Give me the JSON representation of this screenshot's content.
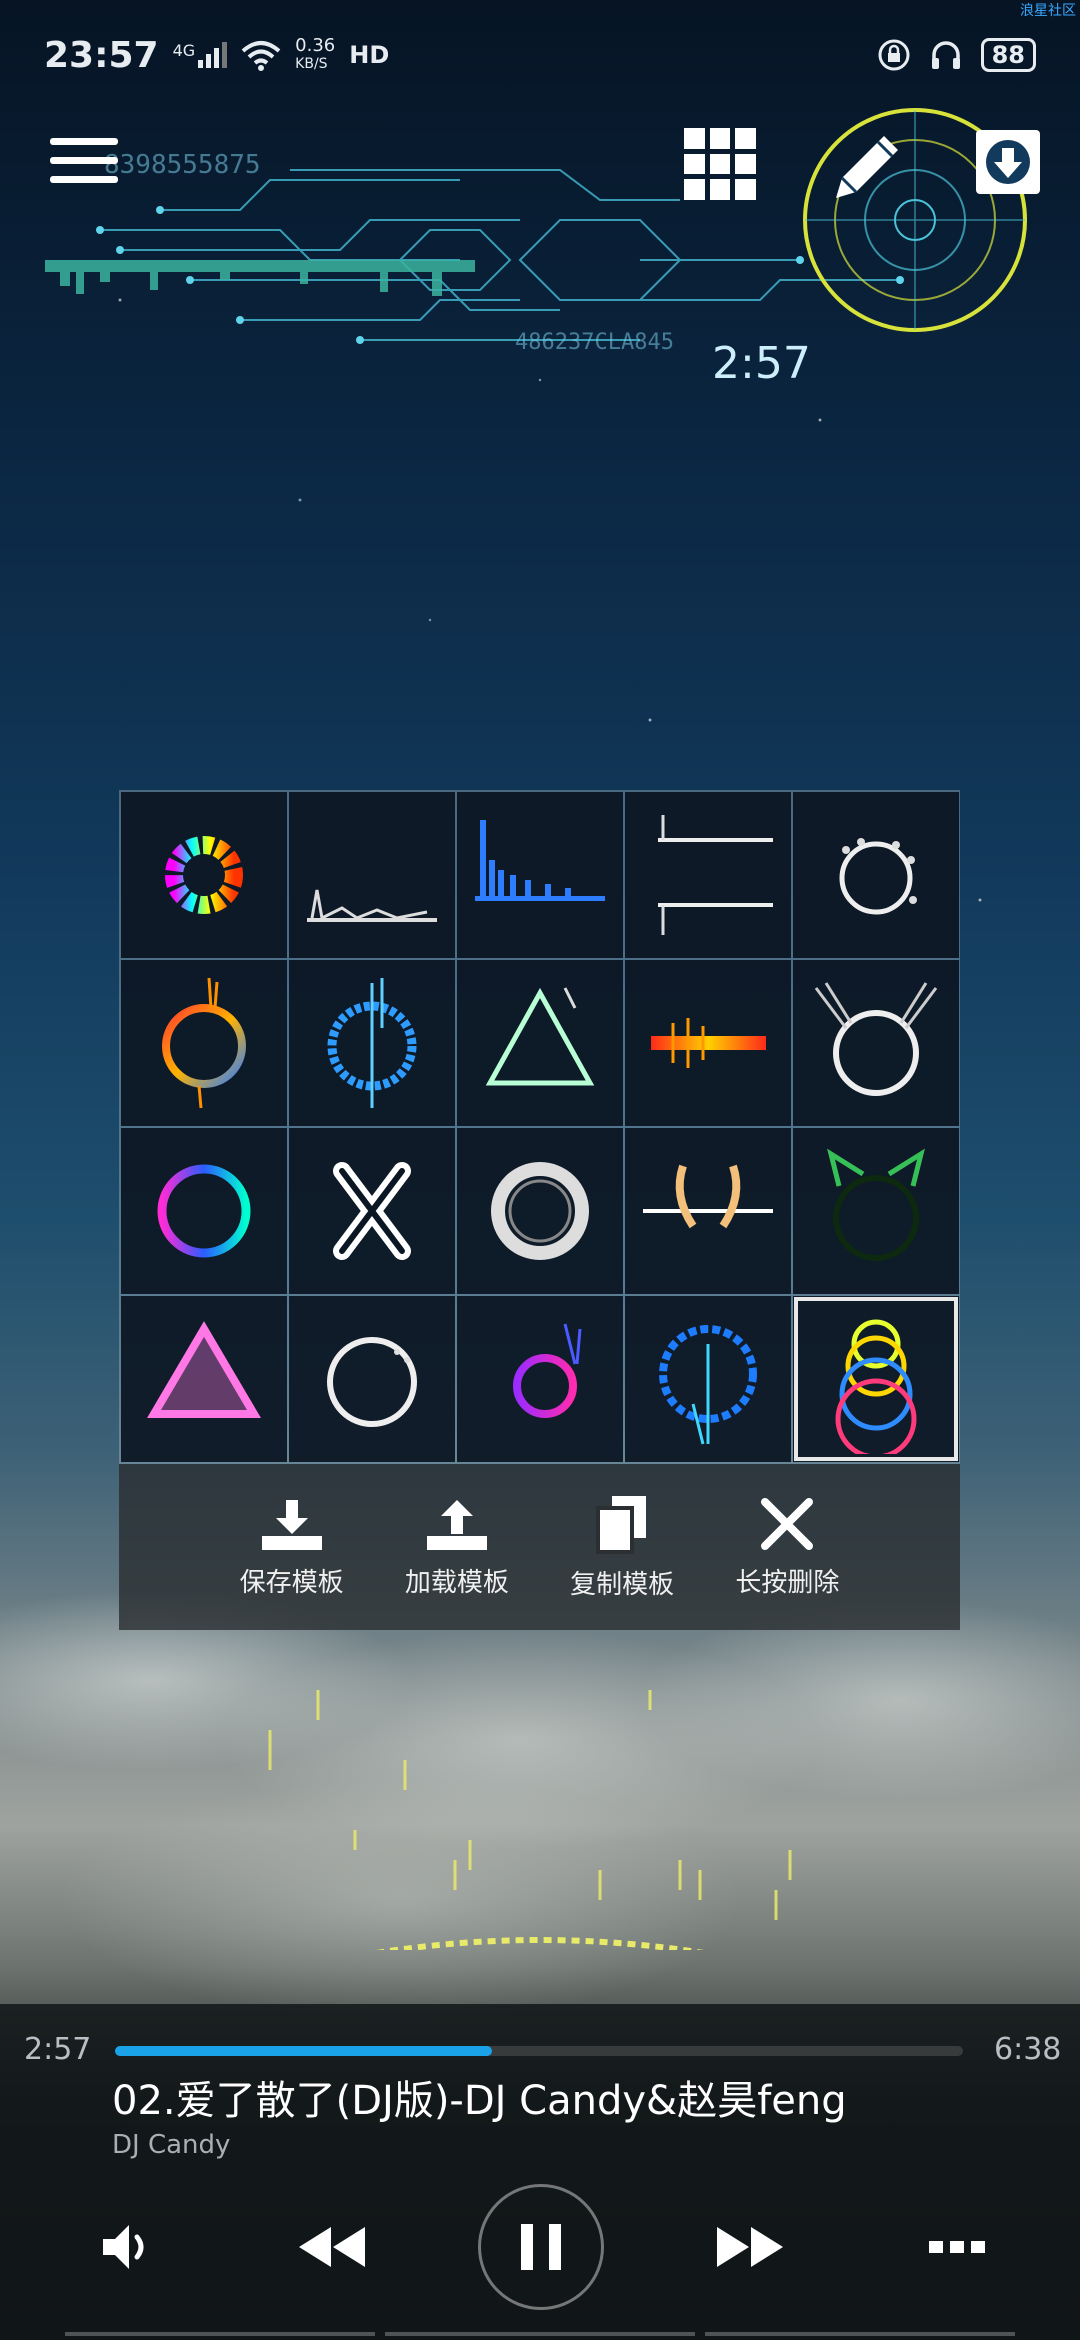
{
  "status_bar": {
    "time": "23:57",
    "network": "4G",
    "speed_value": "0.36",
    "speed_unit": "KB/S",
    "hd": "HD",
    "battery": "88",
    "corner_text": "浪星社区"
  },
  "header": {
    "deco_id": "8398555875",
    "deco_code": "486237CLA845",
    "elapsed_display": "2:57"
  },
  "templates": {
    "count": 20,
    "selected_index": 19,
    "icons": [
      "rainbow-ring-icon",
      "spectrum-wave-icon",
      "blue-bars-icon",
      "mirrored-lines-icon",
      "dotted-ring-icon",
      "fire-ring-icon",
      "blue-ring-icon",
      "triangle-icon",
      "flame-bar-icon",
      "winged-ring-icon",
      "neon-ring-icon",
      "x-mark-icon",
      "white-ring-icon",
      "golden-antler-icon",
      "cat-ears-icon",
      "pink-triangle-icon",
      "thin-ring-icon",
      "purple-burst-icon",
      "cyan-ring-icon",
      "stacked-rings-icon"
    ]
  },
  "actions": [
    {
      "label": "保存模板",
      "icon": "download-tray-icon"
    },
    {
      "label": "加载模板",
      "icon": "upload-tray-icon"
    },
    {
      "label": "复制模板",
      "icon": "copy-icon"
    },
    {
      "label": "长按删除",
      "icon": "close-icon"
    }
  ],
  "player": {
    "elapsed": "2:57",
    "duration": "6:38",
    "progress": 0.4447,
    "song_title": "02.爱了散了(DJ版)-DJ Candy&赵昊feng",
    "artist": "DJ Candy"
  },
  "colors": {
    "accent": "#1aa3e8",
    "radar": "#d7e23a"
  }
}
